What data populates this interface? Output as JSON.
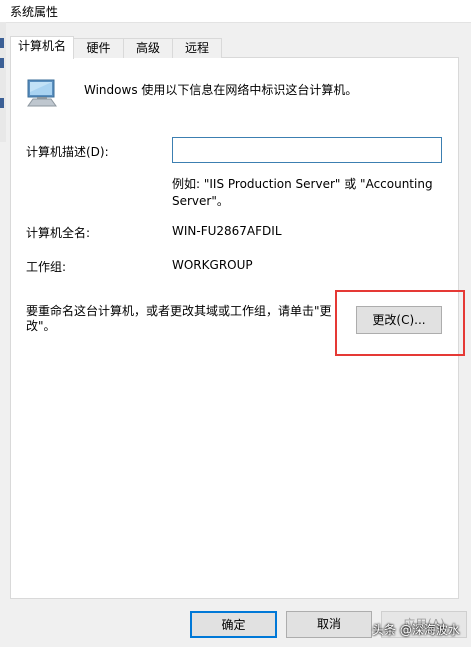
{
  "window": {
    "title": "系统属性"
  },
  "tabs": [
    {
      "label": "计算机名",
      "active": true
    },
    {
      "label": "硬件",
      "active": false
    },
    {
      "label": "高级",
      "active": false
    },
    {
      "label": "远程",
      "active": false
    }
  ],
  "content": {
    "intro": "Windows 使用以下信息在网络中标识这台计算机。",
    "description_label": "计算机描述(D):",
    "description_value": "",
    "example_line1": "例如: \"IIS Production Server\" 或 \"Accounting",
    "example_line2": "Server\"。",
    "full_name_label": "计算机全名:",
    "full_name_value": "WIN-FU2867AFDIL",
    "workgroup_label": "工作组:",
    "workgroup_value": "WORKGROUP",
    "rename_text_line1": "要重命名这台计算机，或者更改其域或工作组，请单击\"更",
    "rename_text_line2": "改\"。",
    "change_button": "更改(C)..."
  },
  "footer": {
    "ok": "确定",
    "cancel": "取消",
    "apply": "应用(A)"
  },
  "watermark": "头条 @深海波水",
  "colors": {
    "highlight": "#e53935",
    "focus_border": "#0078d7",
    "input_border": "#3c7fb1"
  },
  "icons": {
    "computer": "desktop-computer-icon"
  }
}
